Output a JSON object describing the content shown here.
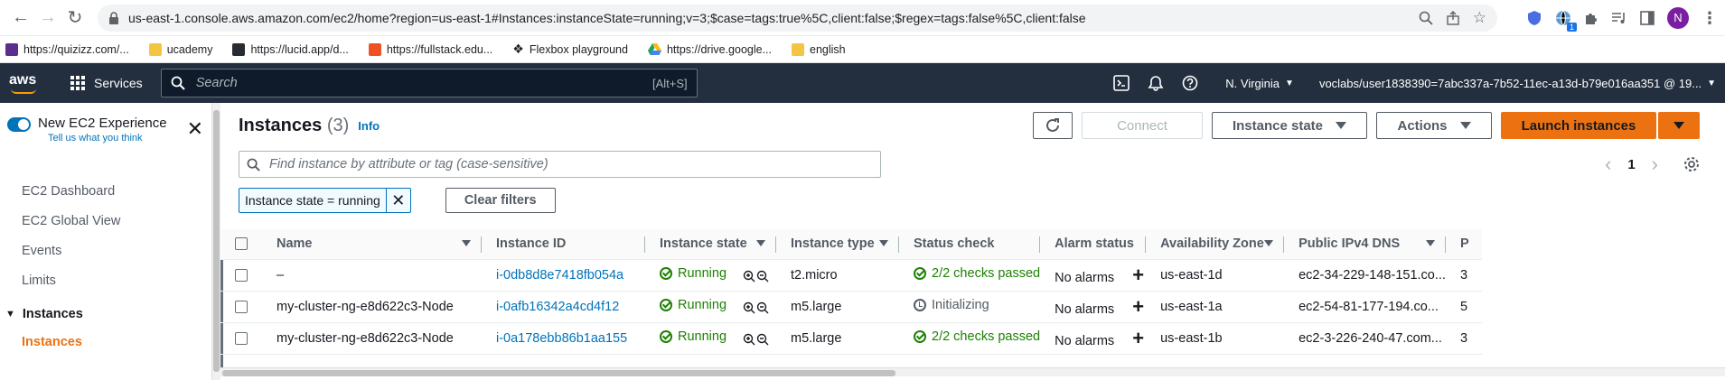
{
  "browser": {
    "url": "us-east-1.console.aws.amazon.com/ec2/home?region=us-east-1#Instances:instanceState=running;v=3;$case=tags:true%5C,client:false;$regex=tags:false%5C,client:false",
    "profile_initial": "N",
    "ext_badge": "1"
  },
  "bookmarks": [
    {
      "label": "https://quizizz.com/...",
      "color": "#5c2d91"
    },
    {
      "label": "ucademy",
      "color": "#f4c542"
    },
    {
      "label": "https://lucid.app/d...",
      "color": "#282c33"
    },
    {
      "label": "https://fullstack.edu...",
      "color": "#f05123"
    },
    {
      "label": "Flexbox playground",
      "color": "#222222"
    },
    {
      "label": "https://drive.google...",
      "color": "#1fa463"
    },
    {
      "label": "english",
      "color": "#f4c542"
    }
  ],
  "aws_nav": {
    "logo": "aws",
    "services": "Services",
    "search_placeholder": "Search",
    "search_shortcut": "[Alt+S]",
    "region": "N. Virginia",
    "account": "voclabs/user1838390=7abc337a-7b52-11ec-a13d-b79e016aa351 @ 19..."
  },
  "sidenav": {
    "new_experience": "New EC2 Experience",
    "tell_us": "Tell us what you think",
    "links": [
      "EC2 Dashboard",
      "EC2 Global View",
      "Events",
      "Limits"
    ],
    "section": "Instances",
    "active": "Instances"
  },
  "header": {
    "title": "Instances",
    "count": "(3)",
    "info": "Info",
    "connect": "Connect",
    "instance_state": "Instance state",
    "actions": "Actions",
    "launch": "Launch instances"
  },
  "filter": {
    "placeholder": "Find instance by attribute or tag (case-sensitive)",
    "token": "Instance state = running",
    "clear": "Clear filters",
    "page": "1"
  },
  "table": {
    "columns": [
      "Name",
      "Instance ID",
      "Instance state",
      "Instance type",
      "Status check",
      "Alarm status",
      "Availability Zone",
      "Public IPv4 DNS",
      "P"
    ],
    "rows": [
      {
        "name": "–",
        "id": "i-0db8d8e7418fb054a",
        "state": "Running",
        "type": "t2.micro",
        "status": "2/2 checks passed",
        "status_kind": "ok",
        "alarm": "No alarms",
        "az": "us-east-1d",
        "dns": "ec2-34-229-148-151.co...",
        "p": "3"
      },
      {
        "name": "my-cluster-ng-e8d622c3-Node",
        "id": "i-0afb16342a4cd4f12",
        "state": "Running",
        "type": "m5.large",
        "status": "Initializing",
        "status_kind": "pending",
        "alarm": "No alarms",
        "az": "us-east-1a",
        "dns": "ec2-54-81-177-194.co...",
        "p": "5"
      },
      {
        "name": "my-cluster-ng-e8d622c3-Node",
        "id": "i-0a178ebb86b1aa155",
        "state": "Running",
        "type": "m5.large",
        "status": "2/2 checks passed",
        "status_kind": "ok",
        "alarm": "No alarms",
        "az": "us-east-1b",
        "dns": "ec2-3-226-240-47.com...",
        "p": "3"
      }
    ]
  },
  "colors": {
    "aws_nav_bg": "#232f3e",
    "accent_orange": "#ec7211",
    "link_blue": "#0073bb",
    "success_green": "#1d8102"
  }
}
